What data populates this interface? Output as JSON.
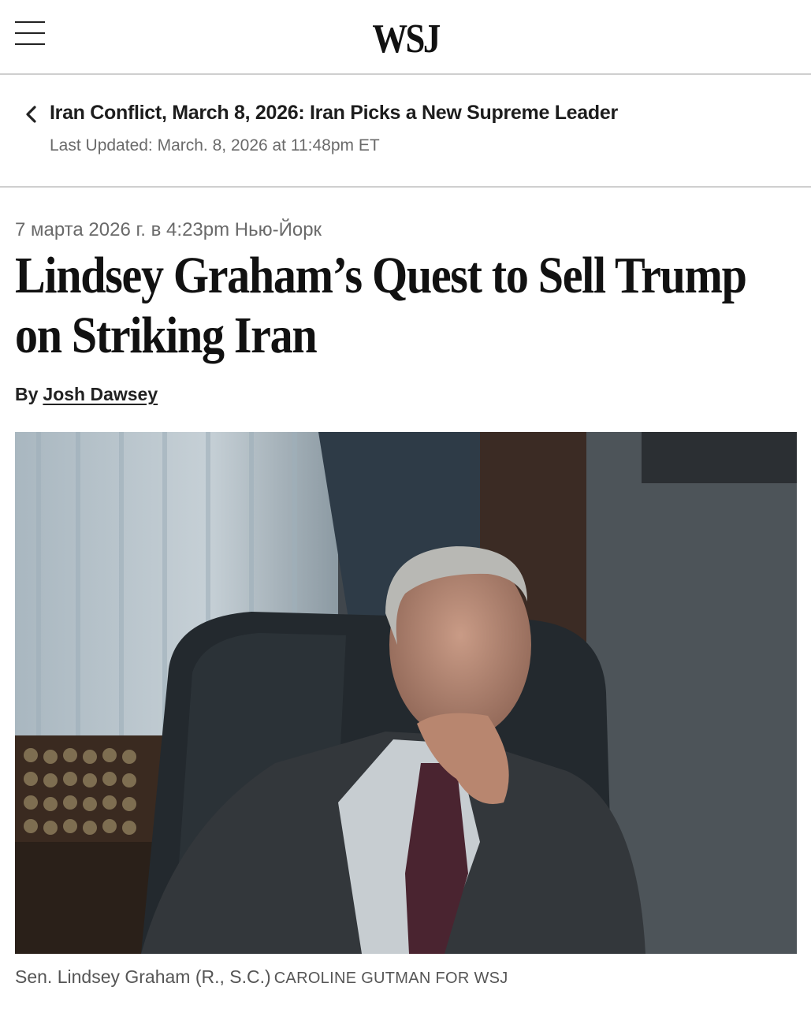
{
  "header": {
    "logo_text": "WSJ",
    "menu_icon": "hamburger-menu-icon"
  },
  "breadcrumb": {
    "back_icon": "chevron-left-icon",
    "title": "Iran Conflict, March 8, 2026: Iran Picks a New Supreme Leader",
    "updated": "Last Updated: March. 8, 2026 at 11:48pm ET"
  },
  "article": {
    "dateline": "7 марта 2026 г. в 4:23pm Нью-Йорк",
    "headline": "Lindsey Graham’s Quest to Sell Trump on Striking Iran",
    "byline_prefix": "By",
    "author": "Josh Dawsey",
    "caption_text": "Sen. Lindsey Graham (R., S.C.)",
    "caption_credit": "CAROLINE GUTMAN FOR WSJ"
  },
  "colors": {
    "text": "#111111",
    "muted": "#6a6a6a",
    "divider": "#cfcfcf"
  }
}
